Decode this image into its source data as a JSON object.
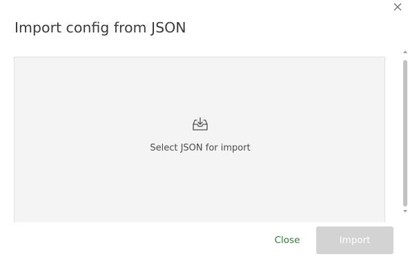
{
  "dialog": {
    "title": "Import config from JSON",
    "close_icon": "close-icon"
  },
  "dropzone": {
    "icon": "upload-icon",
    "label": "Select JSON for import"
  },
  "actions": {
    "close_label": "Close",
    "import_label": "Import",
    "import_enabled": false
  },
  "colors": {
    "title_text": "#3b3b3b",
    "dropzone_bg": "#f4f4f5",
    "dropzone_border": "#e1e1e1",
    "close_text": "#2e7d32",
    "import_bg_disabled": "#d3d3d3",
    "import_text_disabled": "#ffffff"
  }
}
